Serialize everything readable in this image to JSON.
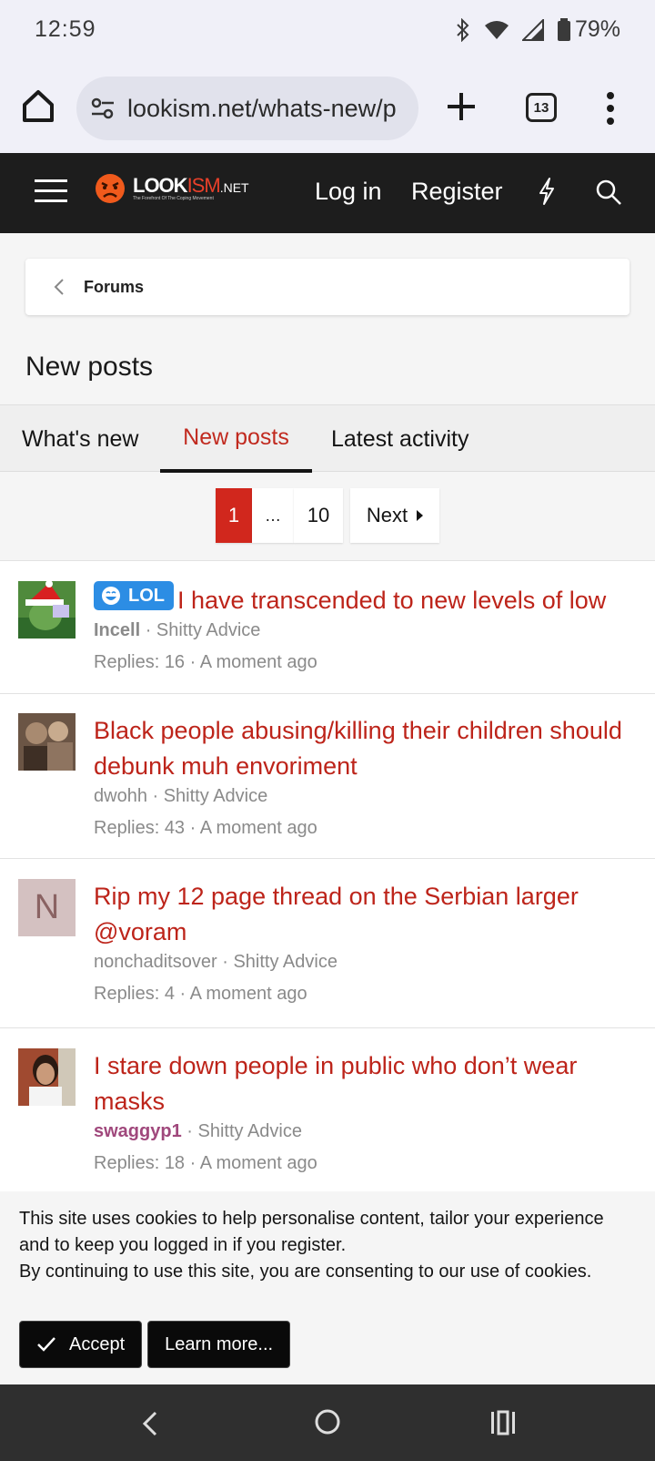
{
  "status": {
    "time": "12:59",
    "battery": "79%"
  },
  "browser": {
    "url": "lookism.net/whats-new/p",
    "tab_count": "13"
  },
  "header": {
    "logo_main": "LOOK",
    "logo_accent": "ISM",
    "logo_suffix": ".NET",
    "logo_tagline": "The Forefront Of The Coping Movement",
    "login": "Log in",
    "register": "Register"
  },
  "breadcrumb": {
    "label": "Forums"
  },
  "page": {
    "title": "New posts"
  },
  "tabs": [
    {
      "label": "What's new"
    },
    {
      "label": "New posts"
    },
    {
      "label": "Latest activity"
    }
  ],
  "pagination": {
    "current": "1",
    "ellipsis": "…",
    "last": "10",
    "next": "Next"
  },
  "threads": [
    {
      "badge": "LOL",
      "title": "I have transcended to new levels of low",
      "author": "Incell",
      "forum": "Shitty Advice",
      "stats": "Replies: 16 · A moment ago"
    },
    {
      "title": "Black people abusing/killing their children should debunk muh envoriment",
      "author": "dwohh",
      "forum": "Shitty Advice",
      "stats": "Replies: 43 · A moment ago"
    },
    {
      "avatar_letter": "N",
      "title": "Rip my 12 page thread on the Serbian larger @voram",
      "author": "nonchaditsover",
      "forum": "Shitty Advice",
      "stats": "Replies: 4 · A moment ago"
    },
    {
      "title": "I stare down people in public who don’t wear masks",
      "author": "swaggyp1",
      "forum": "Shitty Advice",
      "stats": "Replies: 18 · A moment ago"
    }
  ],
  "cookie": {
    "line1": "This site uses cookies to help personalise content, tailor your experience and to keep you logged in if you register.",
    "line2": "By continuing to use this site, you are consenting to our use of cookies.",
    "accept": "Accept",
    "learn_more": "Learn more..."
  },
  "colors": {
    "accent": "#c12a1f",
    "header_bg": "#1d1d1d",
    "badge": "#2c8de4",
    "pink_user": "#a0487c"
  }
}
